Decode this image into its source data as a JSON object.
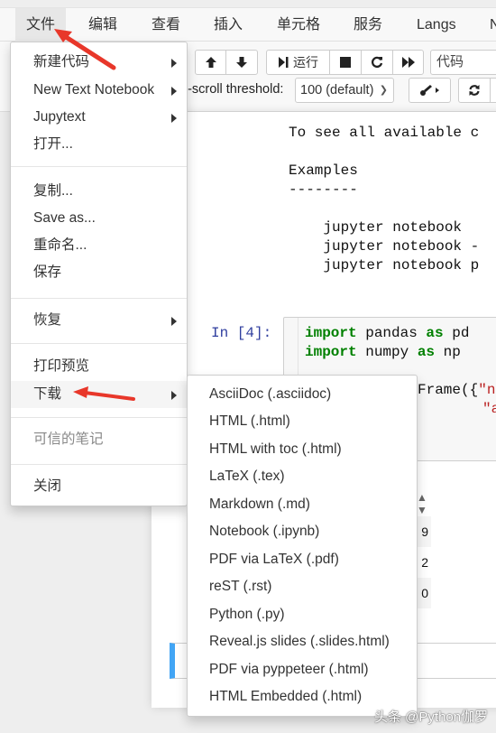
{
  "menubar": {
    "items": [
      {
        "label": "文件",
        "active": true
      },
      {
        "label": "编辑"
      },
      {
        "label": "查看"
      },
      {
        "label": "插入"
      },
      {
        "label": "单元格"
      },
      {
        "label": "服务"
      },
      {
        "label": "Langs"
      },
      {
        "label": "N"
      }
    ]
  },
  "toolbar": {
    "run_label": "运行",
    "cell_type": "代码",
    "threshold_label": "Auto-scroll threshold:",
    "threshold_visible_label": "o-scroll threshold:",
    "threshold_value": "100 (default)",
    "icons": [
      "arrow-up-icon",
      "arrow-down-icon",
      "step-run-icon",
      "stop-icon",
      "restart-icon",
      "fast-forward-icon",
      "paintbrush-icon",
      "refresh-icon"
    ]
  },
  "file_menu": {
    "items": [
      {
        "label": "新建代码",
        "submenu": true
      },
      {
        "label": "New Text Notebook",
        "submenu": true
      },
      {
        "label": "Jupytext",
        "submenu": true
      },
      {
        "label": "打开..."
      },
      {
        "label": "复制..."
      },
      {
        "label": "Save as..."
      },
      {
        "label": "重命名..."
      },
      {
        "label": "保存"
      },
      {
        "label": "恢复",
        "submenu": true
      },
      {
        "label": "打印预览"
      },
      {
        "label": "下载",
        "submenu": true,
        "highlighted": true
      },
      {
        "label": "可信的笔记",
        "disabled": true
      },
      {
        "label": "关闭"
      }
    ]
  },
  "download_menu": {
    "items": [
      {
        "label": "AsciiDoc (.asciidoc)"
      },
      {
        "label": "HTML (.html)"
      },
      {
        "label": "HTML with toc (.html)"
      },
      {
        "label": "LaTeX (.tex)"
      },
      {
        "label": "Markdown (.md)"
      },
      {
        "label": "Notebook (.ipynb)"
      },
      {
        "label": "PDF via LaTeX (.pdf)"
      },
      {
        "label": "reST (.rst)"
      },
      {
        "label": "Python (.py)"
      },
      {
        "label": "Reveal.js slides (.slides.html)"
      },
      {
        "label": "PDF via pyppeteer (.html)"
      },
      {
        "label": "HTML Embedded (.html)"
      }
    ]
  },
  "notebook": {
    "output_lines": [
      "To see all available c",
      "",
      "Examples",
      "--------",
      "",
      "    jupyter notebook",
      "    jupyter notebook -",
      "    jupyter notebook p"
    ],
    "cell_prompt": "In [4]:",
    "code": {
      "line1": {
        "kw1": "import",
        "mid": " pandas ",
        "kw2": "as",
        "end": " pd"
      },
      "line2": {
        "kw1": "import",
        "mid": " numpy ",
        "kw2": "as",
        "end": " np"
      },
      "line3": {
        "text": "Frame({",
        "str": "\"n"
      },
      "line4": {
        "str": "\"a"
      }
    },
    "dataframe_visible_values": [
      "9",
      "2",
      "0"
    ],
    "dataframe_visible_prefix": [
      "",
      "'",
      "'"
    ]
  },
  "colors": {
    "accent_blue": "#42a5f5",
    "prompt_color": "#303f9f",
    "keyword_green": "#008000",
    "string_red": "#ba2121",
    "annotation_arrow": "#e8372a"
  },
  "watermark": "头条 @Python伽罗"
}
